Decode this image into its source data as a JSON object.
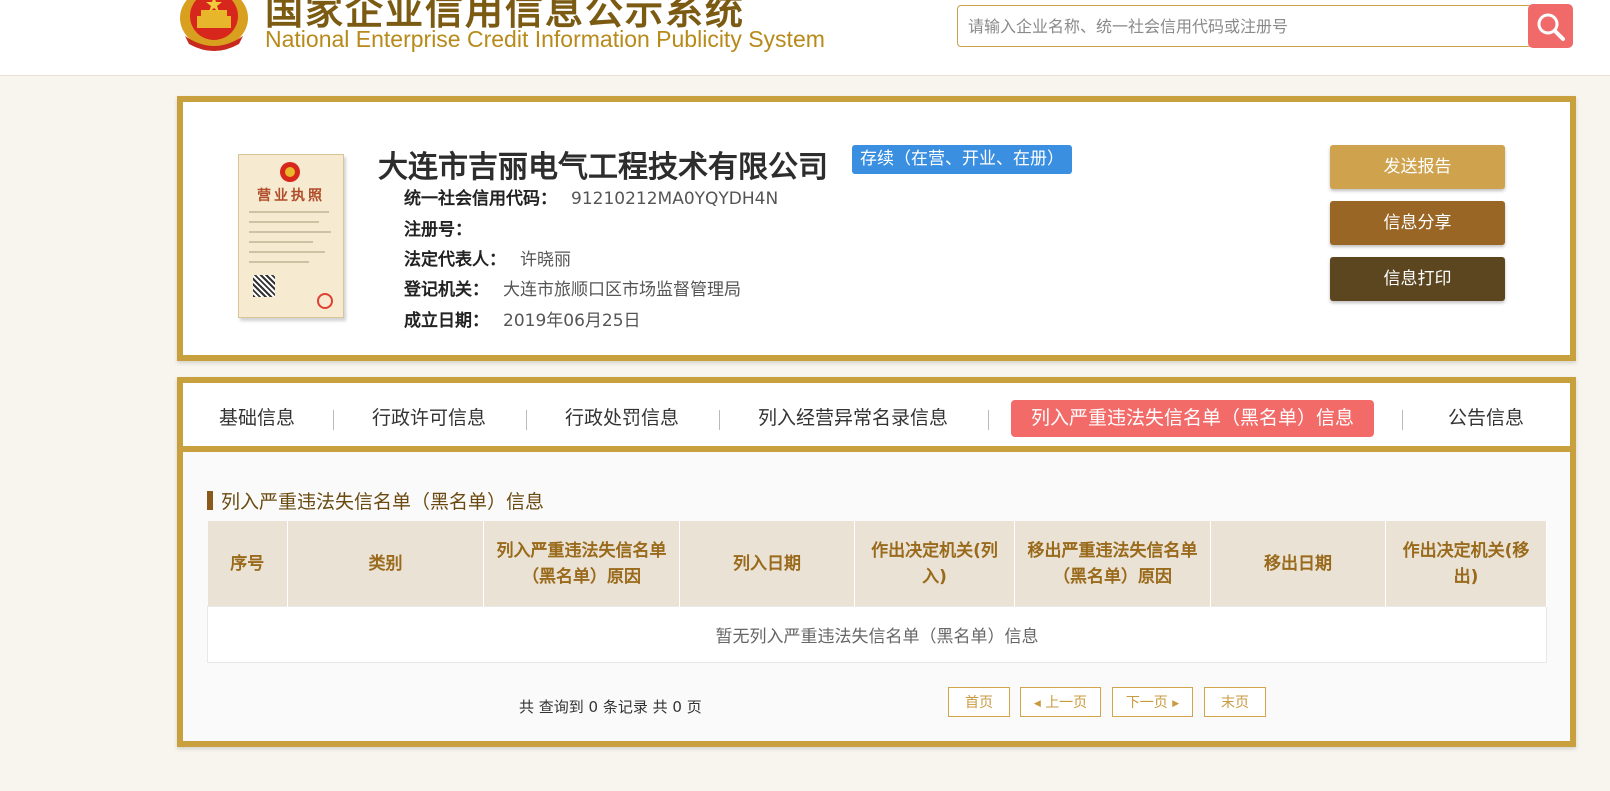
{
  "header": {
    "title_cn": "国家企业信用信息公示系统",
    "title_en": "National Enterprise Credit Information Publicity System",
    "search_placeholder": "请输入企业名称、统一社会信用代码或注册号",
    "search_value": "",
    "search_icon": "search-icon"
  },
  "company": {
    "name": "大连市吉丽电气工程技术有限公司",
    "status": "存续（在营、开业、在册）",
    "license_title": "营业执照",
    "fields": [
      {
        "label": "统一社会信用代码：",
        "value": "91210212MA0YQYDH4N"
      },
      {
        "label": "注册号：",
        "value": ""
      },
      {
        "label": "法定代表人：",
        "value": "许晓丽"
      },
      {
        "label": "登记机关：",
        "value": "大连市旅顺口区市场监督管理局"
      },
      {
        "label": "成立日期：",
        "value": "2019年06月25日"
      }
    ],
    "actions": [
      {
        "label": "发送报告",
        "color": "#cfa24e"
      },
      {
        "label": "信息分享",
        "color": "#9a6626"
      },
      {
        "label": "信息打印",
        "color": "#5c4620"
      }
    ]
  },
  "tabs": [
    {
      "label": "基础信息",
      "active": false
    },
    {
      "label": "行政许可信息",
      "active": false
    },
    {
      "label": "行政处罚信息",
      "active": false
    },
    {
      "label": "列入经营异常名录信息",
      "active": false
    },
    {
      "label": "列入严重违法失信名单（黑名单）信息",
      "active": true
    },
    {
      "label": "公告信息",
      "active": false
    }
  ],
  "section": {
    "title": "列入严重违法失信名单（黑名单）信息",
    "columns": [
      "序号",
      "类别",
      "列入严重违法失信名单（黑名单）原因",
      "列入日期",
      "作出决定机关(列入)",
      "移出严重违法失信名单（黑名单）原因",
      "移出日期",
      "作出决定机关(移出)"
    ],
    "empty_text": "暂无列入严重违法失信名单（黑名单）信息"
  },
  "pagination": {
    "summary": "共 查询到 0 条记录 共 0 页",
    "first": "首页",
    "prev": "上一页",
    "next": "下一页",
    "last": "末页"
  },
  "colors": {
    "gold_border": "#c9a03e",
    "active_tab": "#f26b68",
    "status_badge": "#3a8fe0",
    "search_button": "#f06a6a"
  }
}
